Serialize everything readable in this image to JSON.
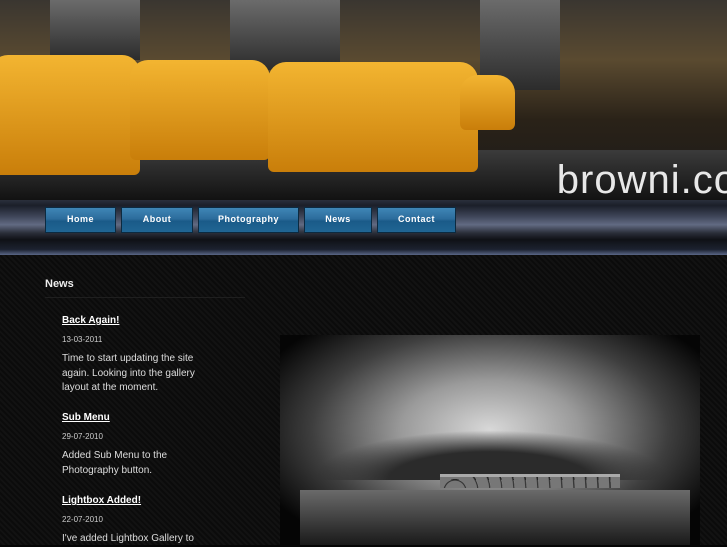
{
  "header": {
    "logo_text": "browni.co"
  },
  "nav": [
    {
      "label": "Home"
    },
    {
      "label": "About"
    },
    {
      "label": "Photography"
    },
    {
      "label": "News"
    },
    {
      "label": "Contact"
    }
  ],
  "news": {
    "heading": "News",
    "items": [
      {
        "title": "Back Again!",
        "date": "13-03-2011",
        "text": "Time to start updating the site again. Looking into the gallery layout at the moment."
      },
      {
        "title": "Sub Menu",
        "date": "29-07-2010",
        "text": "Added Sub Menu to the Photography button."
      },
      {
        "title": "Lightbox Added!",
        "date": "22-07-2010",
        "text": "I've added Lightbox Gallery to"
      }
    ]
  }
}
